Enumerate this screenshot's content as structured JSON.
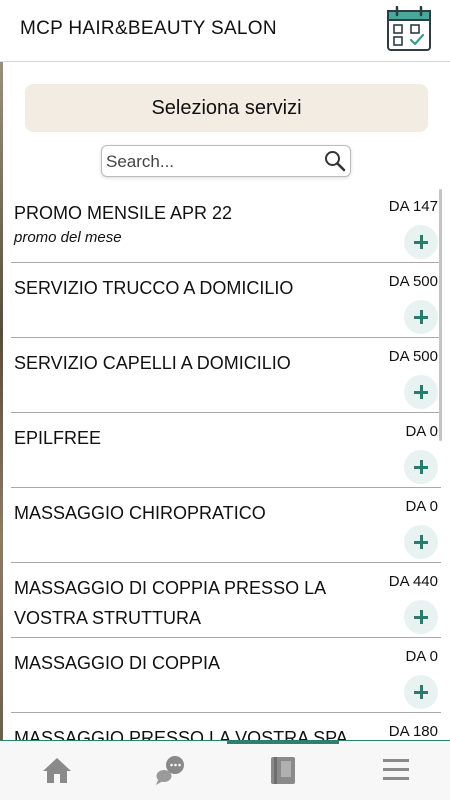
{
  "header": {
    "title": "MCP HAIR&BEAUTY SALON",
    "calendar_icon": "calendar-check-icon"
  },
  "main": {
    "section_title": "Seleziona servizi",
    "search": {
      "placeholder": "Search...",
      "value": ""
    }
  },
  "services": [
    {
      "name": "PROMO MENSILE APR 22",
      "subtitle": "promo del mese",
      "price": "DA 147"
    },
    {
      "name": "SERVIZIO TRUCCO A DOMICILIO",
      "subtitle": "",
      "price": "DA 500"
    },
    {
      "name": "SERVIZIO CAPELLI A DOMICILIO",
      "subtitle": "",
      "price": "DA 500"
    },
    {
      "name": "EPILFREE",
      "subtitle": "",
      "price": "DA 0"
    },
    {
      "name": "MASSAGGIO CHIROPRATICO",
      "subtitle": "",
      "price": "DA 0"
    },
    {
      "name": "MASSAGGIO DI COPPIA PRESSO LA VOSTRA STRUTTURA",
      "subtitle": "",
      "price": "DA 440"
    },
    {
      "name": "MASSAGGIO DI COPPIA",
      "subtitle": "",
      "price": "DA 0"
    },
    {
      "name": "MASSAGGIO PRESSO LA VOSTRA SPA",
      "subtitle": "",
      "price": "DA 180"
    }
  ],
  "tabbar": {
    "tabs": [
      {
        "icon": "home-icon"
      },
      {
        "icon": "chat-icon"
      },
      {
        "icon": "book-icon"
      },
      {
        "icon": "menu-icon"
      }
    ],
    "active_index": 2
  },
  "colors": {
    "accent": "#2d7f72",
    "header_bg": "#f2ece2",
    "add_button_bg": "#e8f3f1"
  }
}
